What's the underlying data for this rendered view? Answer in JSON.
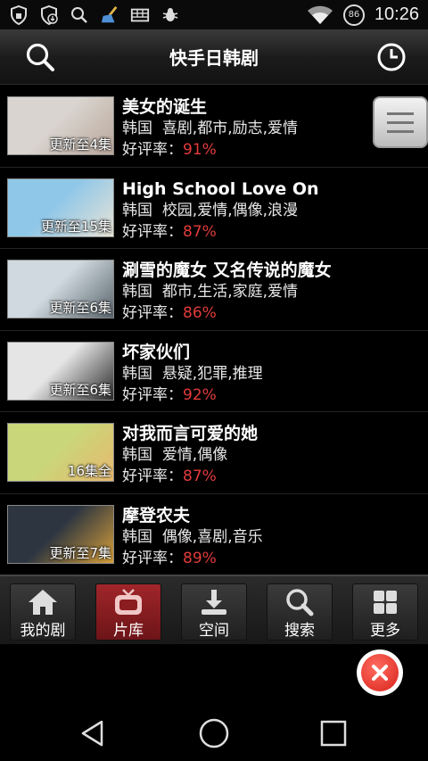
{
  "status_bar": {
    "time": "10:26",
    "battery": "86",
    "icons": [
      "shield-lock-icon",
      "shield-download-icon",
      "search-icon",
      "broom-icon",
      "keyboard-icon",
      "bug-icon",
      "wifi-icon",
      "battery-icon"
    ]
  },
  "header": {
    "title": "快手日韩剧",
    "left_icon": "search-icon",
    "right_icon": "clock-icon"
  },
  "shows": [
    {
      "title": "美女的诞生",
      "country": "韩国",
      "genres": "喜剧,都市,励志,爱情",
      "rating_label": "好评率：",
      "rating": "91%",
      "episodes": "更新至4集",
      "poster_colors": [
        "#d9d4cf",
        "#b9a79a"
      ]
    },
    {
      "title": "High School Love On",
      "country": "韩国",
      "genres": "校园,爱情,偶像,浪漫",
      "rating_label": "好评率：",
      "rating": "87%",
      "episodes": "更新至15集",
      "poster_colors": [
        "#8fc7e8",
        "#e9e3d6"
      ]
    },
    {
      "title": "涮雪的魔女 又名传说的魔女",
      "country": "韩国",
      "genres": "都市,生活,家庭,爱情",
      "rating_label": "好评率：",
      "rating": "86%",
      "episodes": "更新至6集",
      "poster_colors": [
        "#cfd9df",
        "#59636b"
      ]
    },
    {
      "title": "坏家伙们",
      "country": "韩国",
      "genres": "悬疑,犯罪,推理",
      "rating_label": "好评率：",
      "rating": "92%",
      "episodes": "更新至6集",
      "poster_colors": [
        "#e5e5e5",
        "#2b2b2b"
      ]
    },
    {
      "title": "对我而言可爱的她",
      "country": "韩国",
      "genres": "爱情,偶像",
      "rating_label": "好评率：",
      "rating": "87%",
      "episodes": "16集全",
      "poster_colors": [
        "#c9d77a",
        "#e7b86f"
      ]
    },
    {
      "title": "摩登农夫",
      "country": "韩国",
      "genres": "偶像,喜剧,音乐",
      "rating_label": "好评率：",
      "rating": "89%",
      "episodes": "更新至7集",
      "poster_colors": [
        "#2d3540",
        "#d8a03a"
      ]
    }
  ],
  "tabs": [
    {
      "label": "我的剧",
      "icon": "home-icon",
      "active": false
    },
    {
      "label": "片库",
      "icon": "tv-icon",
      "active": true
    },
    {
      "label": "空间",
      "icon": "download-icon",
      "active": false
    },
    {
      "label": "搜索",
      "icon": "search-icon",
      "active": false
    },
    {
      "label": "更多",
      "icon": "grid-icon",
      "active": false
    }
  ],
  "colors": {
    "accent": "#a0262a",
    "rating": "#e23b3b",
    "background": "#000000"
  },
  "navigation": {
    "back": "back-icon",
    "home": "home-circle-icon",
    "recents": "recents-icon"
  }
}
